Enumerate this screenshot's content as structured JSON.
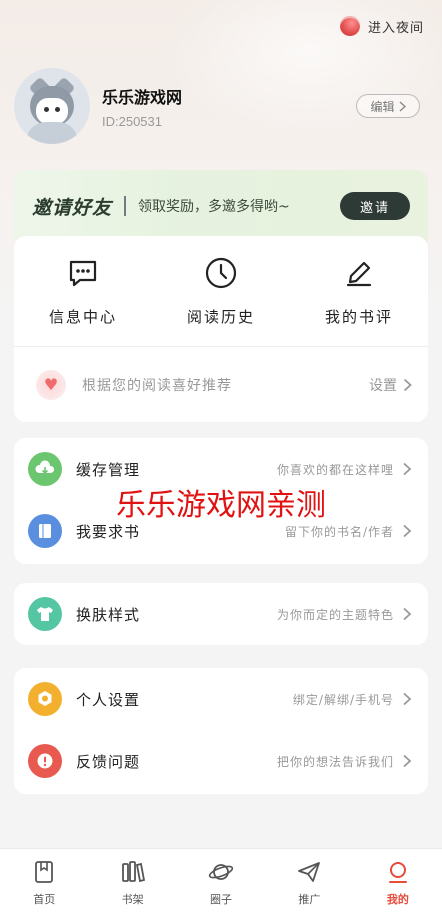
{
  "header": {
    "night_mode_label": "进入夜间",
    "edit_label": "编辑"
  },
  "profile": {
    "name": "乐乐游戏网",
    "id_text": "ID:250531"
  },
  "invite": {
    "title": "邀请好友",
    "subtitle": "领取奖励，多邀多得哟~",
    "button_label": "邀请"
  },
  "quick_actions": [
    {
      "label": "信息中心",
      "icon": "message-icon"
    },
    {
      "label": "阅读历史",
      "icon": "clock-icon"
    },
    {
      "label": "我的书评",
      "icon": "pencil-icon"
    }
  ],
  "recommendation": {
    "text": "根据您的阅读喜好推荐",
    "settings_label": "设置"
  },
  "menu_groups": [
    [
      {
        "name": "缓存管理",
        "desc": "你喜欢的都在这样哩",
        "icon": "download-cloud-icon",
        "color": "#6cc56f"
      },
      {
        "name": "我要求书",
        "desc": "留下你的书名/作者",
        "icon": "book-icon",
        "color": "#5a8fe0"
      }
    ],
    [
      {
        "name": "换肤样式",
        "desc": "为你而定的主题特色",
        "icon": "tshirt-icon",
        "color": "#55c6a3"
      }
    ],
    [
      {
        "name": "个人设置",
        "desc": "绑定/解绑/手机号",
        "icon": "gear-icon",
        "color": "#f2b02e"
      },
      {
        "name": "反馈问题",
        "desc": "把你的想法告诉我们",
        "icon": "alert-icon",
        "color": "#e85a4f"
      }
    ]
  ],
  "watermark": "乐乐游戏网亲测",
  "tabbar": {
    "tabs": [
      {
        "label": "首页",
        "icon": "home-icon"
      },
      {
        "label": "书架",
        "icon": "bookshelf-icon"
      },
      {
        "label": "圈子",
        "icon": "planet-icon"
      },
      {
        "label": "推广",
        "icon": "send-icon"
      },
      {
        "label": "我的",
        "icon": "profile-icon"
      }
    ],
    "active_index": 4,
    "active_color": "#e64b3c"
  }
}
